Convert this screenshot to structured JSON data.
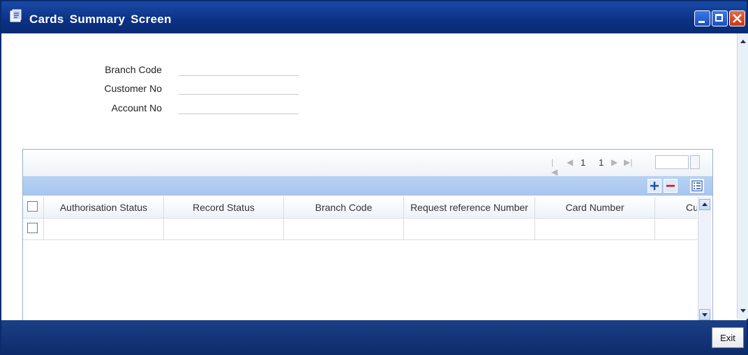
{
  "window": {
    "title_words": [
      "Cards",
      "Summary",
      "Screen"
    ],
    "icons": [
      "window-app-icon",
      "minimize-icon",
      "maximize-icon",
      "close-icon"
    ]
  },
  "form": {
    "fields": [
      {
        "label": "Branch Code",
        "value": ""
      },
      {
        "label": "Customer No",
        "value": ""
      },
      {
        "label": "Account No",
        "value": ""
      }
    ]
  },
  "pager": {
    "current_page": "1",
    "total_pages": "1",
    "goto_value": ""
  },
  "grid": {
    "columns": [
      "Authorisation Status",
      "Record Status",
      "Branch Code",
      "Request reference Number",
      "Card Number",
      "Cu"
    ],
    "rows": [
      [
        "",
        "",
        "",
        "",
        "",
        ""
      ]
    ]
  },
  "footer": {
    "exit_label": "Exit"
  },
  "colors": {
    "titlebar": "#0b3184",
    "footer": "#1b3f86",
    "action_bar": "#b8d2f2",
    "delete_icon": "#d01818",
    "add_icon": "#1f4fa8"
  }
}
